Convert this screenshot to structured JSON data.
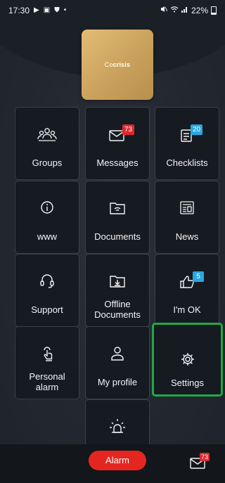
{
  "status_bar": {
    "time": "17:30",
    "battery": "22%",
    "icons": [
      "play-store-icon",
      "gallery-icon",
      "shield-icon",
      "dot-icon",
      "mute-icon",
      "wifi-icon",
      "signal-icon",
      "battery-icon"
    ]
  },
  "logo": {
    "text_prefix": "Co",
    "text_bold": "crisis"
  },
  "tiles": {
    "groups": {
      "label": "Groups",
      "icon": "groups-icon"
    },
    "messages": {
      "label": "Messages",
      "icon": "envelope-icon",
      "badge": "73"
    },
    "checklists": {
      "label": "Checklists",
      "icon": "checklist-icon",
      "badge": "20"
    },
    "www": {
      "label": "www",
      "icon": "info-icon"
    },
    "documents": {
      "label": "Documents",
      "icon": "folder-wifi-icon"
    },
    "news": {
      "label": "News",
      "icon": "newspaper-icon"
    },
    "support": {
      "label": "Support",
      "icon": "headset-icon"
    },
    "offline_documents": {
      "label": "Offline Documents",
      "icon": "folder-download-icon"
    },
    "im_ok": {
      "label": "I'm OK",
      "icon": "thumbs-up-icon",
      "badge": "5"
    },
    "personal_alarm": {
      "label": "Personal alarm",
      "icon": "touch-hand-icon"
    },
    "my_profile": {
      "label": "My profile",
      "icon": "person-icon"
    },
    "settings": {
      "label": "Settings",
      "icon": "gear-icon"
    },
    "alarm_tile": {
      "icon": "siren-icon"
    }
  },
  "bottom_bar": {
    "alarm_label": "Alarm",
    "message_badge": "73"
  },
  "colors": {
    "background": "#23272f",
    "tile": "#161a21",
    "badge_red": "#e0282e",
    "badge_blue": "#2aa7e0",
    "selected_outline": "#21a846",
    "alarm_button": "#e52620",
    "logo_gold": "#d4ac66"
  }
}
